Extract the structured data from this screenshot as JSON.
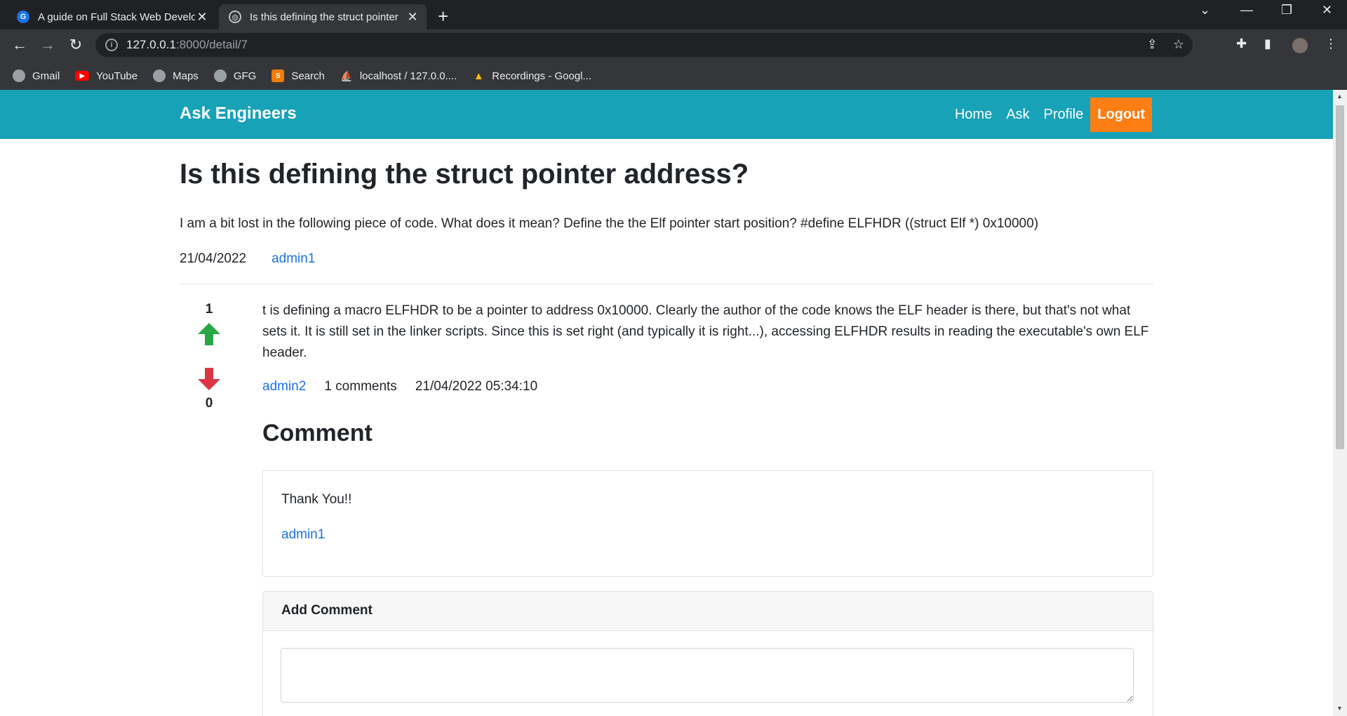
{
  "browser": {
    "tabs": [
      {
        "title": "A guide on Full Stack Web Develo",
        "active": false
      },
      {
        "title": "Is this defining the struct pointer",
        "active": true
      }
    ],
    "url_host": "127.0.0.1",
    "url_path": ":8000/detail/7",
    "bookmarks": [
      {
        "label": "Gmail",
        "icon": "globe-icon"
      },
      {
        "label": "YouTube",
        "icon": "youtube-icon"
      },
      {
        "label": "Maps",
        "icon": "globe-icon"
      },
      {
        "label": "GFG",
        "icon": "globe-icon"
      },
      {
        "label": "Search",
        "icon": "search-app-icon"
      },
      {
        "label": "localhost / 127.0.0....",
        "icon": "phpmyadmin-icon"
      },
      {
        "label": "Recordings - Googl...",
        "icon": "google-drive-icon"
      }
    ]
  },
  "site": {
    "brand": "Ask Engineers",
    "nav": {
      "home": "Home",
      "ask": "Ask",
      "profile": "Profile",
      "logout": "Logout"
    },
    "colors": {
      "navbar": "#17a2b8",
      "logout": "#fd7e14",
      "link": "#1a73e8",
      "upvote": "#28a745",
      "downvote": "#dc3545"
    }
  },
  "question": {
    "title": "Is this defining the struct pointer address?",
    "body": "I am a bit lost in the following piece of code. What does it mean? Define the the Elf pointer start position? #define ELFHDR ((struct Elf *) 0x10000)",
    "date": "21/04/2022",
    "author": "admin1"
  },
  "answer": {
    "upvotes": "1",
    "downvotes": "0",
    "text": "t is defining a macro ELFHDR to be a pointer to address 0x10000. Clearly the author of the code knows the ELF header is there, but that's not what sets it. It is still set in the linker scripts. Since this is set right (and typically it is right...), accessing ELFHDR results in reading the executable's own ELF header.",
    "author": "admin2",
    "comments_count": "1 comments",
    "datetime": "21/04/2022 05:34:10"
  },
  "comments": {
    "heading": "Comment",
    "items": [
      {
        "text": "Thank You!!",
        "author": "admin1"
      }
    ],
    "add_heading": "Add Comment",
    "add_value": ""
  }
}
